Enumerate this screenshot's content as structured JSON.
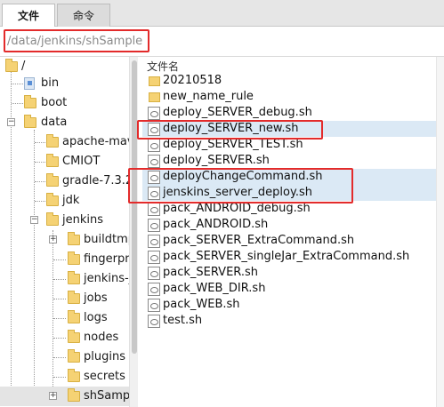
{
  "tabs": [
    {
      "label": "文件"
    },
    {
      "label": "命令"
    }
  ],
  "path": "/data/jenkins/shSample",
  "tree": {
    "root_label": "/",
    "items": [
      {
        "label": "bin"
      },
      {
        "label": "boot"
      },
      {
        "label": "data"
      },
      {
        "label": "apache-mav"
      },
      {
        "label": "CMIOT"
      },
      {
        "label": "gradle-7.3.2"
      },
      {
        "label": "jdk"
      },
      {
        "label": "jenkins"
      },
      {
        "label": "buildtmp"
      },
      {
        "label": "fingerpr"
      },
      {
        "label": "jenkins-j"
      },
      {
        "label": "jobs"
      },
      {
        "label": "logs"
      },
      {
        "label": "nodes"
      },
      {
        "label": "plugins"
      },
      {
        "label": "secrets"
      },
      {
        "label": "shSamp"
      }
    ]
  },
  "filelist": {
    "column_header": "文件名",
    "items": [
      {
        "name": "20210518"
      },
      {
        "name": "new_name_rule"
      },
      {
        "name": "deploy_SERVER_debug.sh"
      },
      {
        "name": "deploy_SERVER_new.sh"
      },
      {
        "name": "deploy_SERVER_TEST.sh"
      },
      {
        "name": "deploy_SERVER.sh"
      },
      {
        "name": "deployChangeCommand.sh"
      },
      {
        "name": "jenskins_server_deploy.sh"
      },
      {
        "name": "pack_ANDROID_debug.sh"
      },
      {
        "name": "pack_ANDROID.sh"
      },
      {
        "name": "pack_SERVER_ExtraCommand.sh"
      },
      {
        "name": "pack_SERVER_singleJar_ExtraCommand.sh"
      },
      {
        "name": "pack_SERVER.sh"
      },
      {
        "name": "pack_WEB_DIR.sh"
      },
      {
        "name": "pack_WEB.sh"
      },
      {
        "name": "test.sh"
      }
    ]
  },
  "colors": {
    "highlight_box": "#e32b2b",
    "selection": "#dbe9f5",
    "folder": "#f5d274"
  }
}
